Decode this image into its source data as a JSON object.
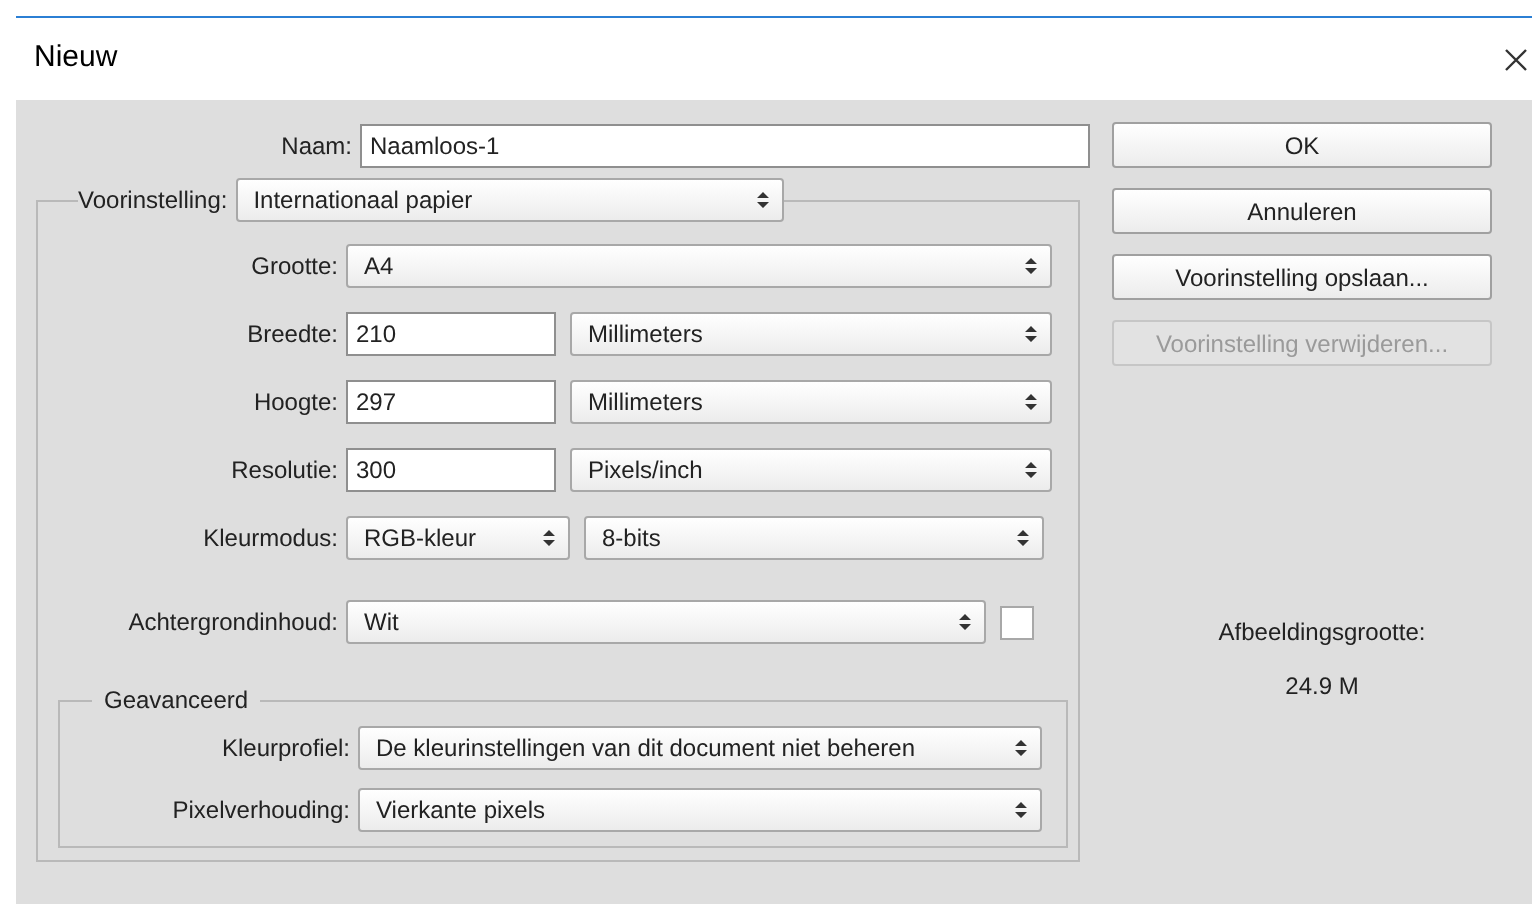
{
  "window": {
    "title": "Nieuw"
  },
  "name_field": {
    "label": "Naam:",
    "value": "Naamloos-1"
  },
  "preset": {
    "label": "Voorinstelling:",
    "value": "Internationaal papier"
  },
  "rows": [
    {
      "label": "Grootte:",
      "controls": [
        {
          "kind": "select",
          "value": "A4"
        }
      ]
    },
    {
      "label": "Breedte:",
      "controls": [
        {
          "kind": "input",
          "value": "210"
        },
        {
          "kind": "select",
          "value": "Millimeters"
        }
      ]
    },
    {
      "label": "Hoogte:",
      "controls": [
        {
          "kind": "input",
          "value": "297"
        },
        {
          "kind": "select",
          "value": "Millimeters"
        }
      ]
    },
    {
      "label": "Resolutie:",
      "controls": [
        {
          "kind": "input",
          "value": "300"
        },
        {
          "kind": "select",
          "value": "Pixels/inch"
        }
      ]
    },
    {
      "label": "Kleurmodus:",
      "controls": [
        {
          "kind": "select",
          "value": "RGB-kleur"
        },
        {
          "kind": "select",
          "value": "8-bits"
        }
      ]
    },
    {
      "label": "Achtergrondinhoud:",
      "controls": [
        {
          "kind": "select",
          "value": "Wit"
        },
        {
          "kind": "swatch"
        }
      ]
    }
  ],
  "advanced": {
    "title": "Geavanceerd",
    "rows": [
      {
        "label": "Kleurprofiel:",
        "value": "De kleurinstellingen van dit document niet beheren"
      },
      {
        "label": "Pixelverhouding:",
        "value": "Vierkante pixels"
      }
    ]
  },
  "buttons": [
    {
      "label": "OK",
      "disabled": false
    },
    {
      "label": "Annuleren",
      "disabled": false
    },
    {
      "label": "Voorinstelling opslaan...",
      "disabled": false
    },
    {
      "label": "Voorinstelling verwijderen...",
      "disabled": true
    }
  ],
  "image_size": {
    "label": "Afbeeldingsgrootte:",
    "value": "24.9 M"
  }
}
